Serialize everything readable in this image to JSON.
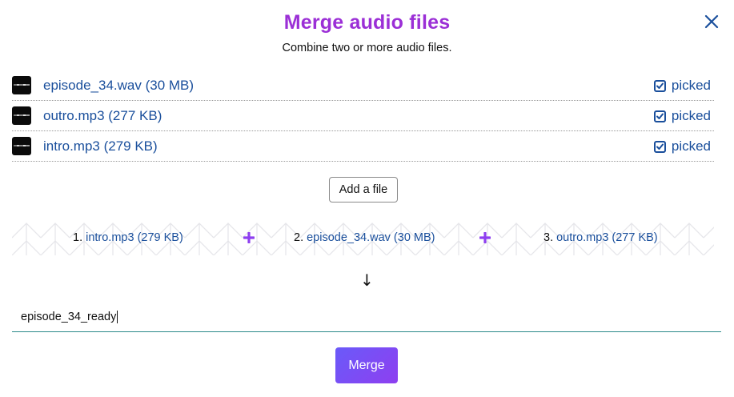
{
  "dialog": {
    "title": "Merge audio files",
    "subtitle": "Combine two or more audio files."
  },
  "files": [
    {
      "name": "episode_34.wav (30 MB)",
      "status": "picked",
      "checked": true
    },
    {
      "name": "outro.mp3 (277 KB)",
      "status": "picked",
      "checked": true
    },
    {
      "name": "intro.mp3 (279 KB)",
      "status": "picked",
      "checked": true
    }
  ],
  "add_file_label": "Add a file",
  "merge_order": [
    {
      "index": "1.",
      "name": "intro.mp3 (279 KB)"
    },
    {
      "index": "2.",
      "name": "episode_34.wav (30 MB)"
    },
    {
      "index": "3.",
      "name": "outro.mp3 (277 KB)"
    }
  ],
  "arrow_glyph": "↓",
  "output": {
    "value": "episode_34_ready"
  },
  "merge_label": "Merge",
  "colors": {
    "title": "#9b2fd6",
    "link": "#1a4f9c",
    "plus": "#8e3ff0",
    "merge_gradient_start": "#6a5af9",
    "merge_gradient_end": "#8e3ff0"
  },
  "icons": {
    "close": "close-icon",
    "checkbox": "checkbox-checked-icon",
    "plus": "plus-icon",
    "thumbnail": "waveform-thumbnail"
  }
}
